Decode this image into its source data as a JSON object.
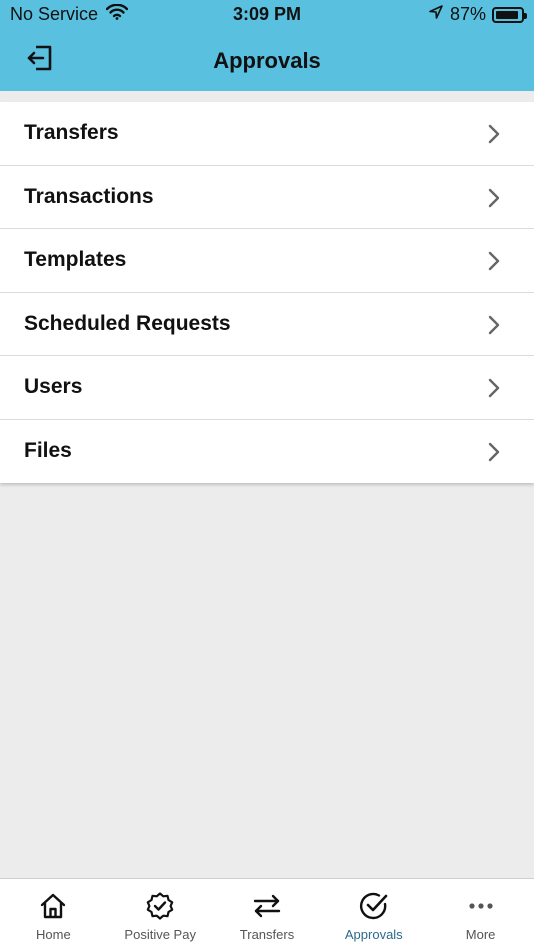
{
  "status": {
    "carrier": "No Service",
    "time": "3:09 PM",
    "battery": "87%"
  },
  "header": {
    "title": "Approvals"
  },
  "list": {
    "items": [
      {
        "label": "Transfers"
      },
      {
        "label": "Transactions"
      },
      {
        "label": "Templates"
      },
      {
        "label": "Scheduled Requests"
      },
      {
        "label": "Users"
      },
      {
        "label": "Files"
      }
    ]
  },
  "tabs": [
    {
      "label": "Home",
      "icon": "home-icon",
      "active": false
    },
    {
      "label": "Positive Pay",
      "icon": "badge-check-icon",
      "active": false
    },
    {
      "label": "Transfers",
      "icon": "arrows-exchange-icon",
      "active": false
    },
    {
      "label": "Approvals",
      "icon": "check-circle-icon",
      "active": true
    },
    {
      "label": "More",
      "icon": "more-dots-icon",
      "active": false
    }
  ],
  "colors": {
    "header_bg": "#59c0df",
    "active_tab": "#2a6a8a",
    "page_bg": "#ececec"
  }
}
